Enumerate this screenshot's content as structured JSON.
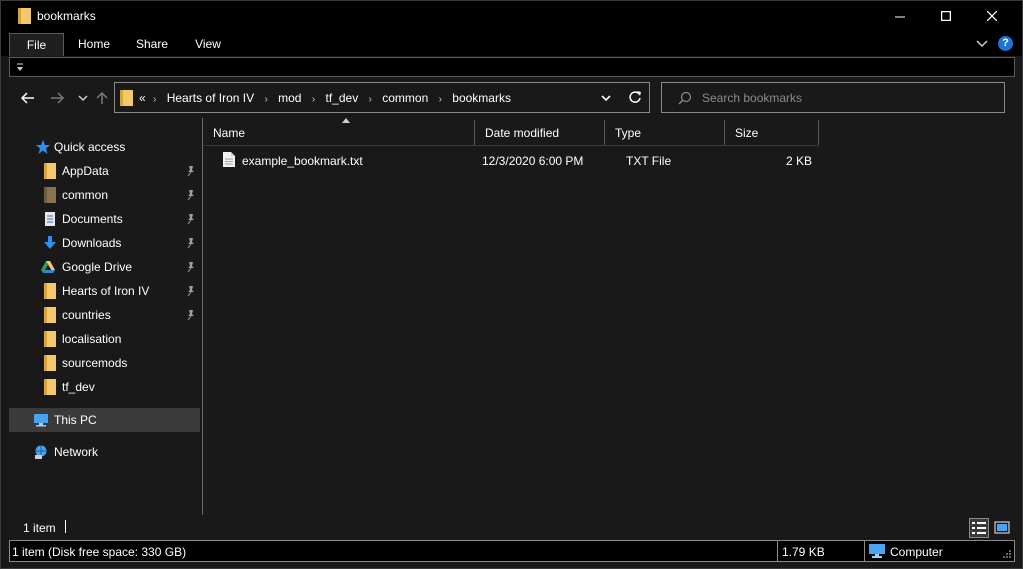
{
  "window": {
    "title": "bookmarks"
  },
  "title_buttons": {
    "minimize": "minimize-icon",
    "maximize": "maximize-icon",
    "close": "close-icon"
  },
  "ribbon": {
    "tabs": [
      {
        "label": "File"
      },
      {
        "label": "Home"
      },
      {
        "label": "Share"
      },
      {
        "label": "View"
      }
    ],
    "help_label": "?"
  },
  "address": {
    "overflow": "«",
    "crumbs": [
      "Hearts of Iron IV",
      "mod",
      "tf_dev",
      "common",
      "bookmarks"
    ],
    "separator": "›"
  },
  "search": {
    "placeholder": "Search bookmarks"
  },
  "sidebar": {
    "items": [
      {
        "label": "Quick access",
        "icon": "star-icon"
      },
      {
        "label": "AppData",
        "icon": "folder-icon",
        "pinned": true
      },
      {
        "label": "common",
        "icon": "folder-icon",
        "pinned": true
      },
      {
        "label": "Documents",
        "icon": "documents-icon",
        "pinned": true
      },
      {
        "label": "Downloads",
        "icon": "download-icon",
        "pinned": true
      },
      {
        "label": "Google Drive",
        "icon": "google-drive-icon",
        "pinned": true
      },
      {
        "label": "Hearts of Iron IV",
        "icon": "folder-icon",
        "pinned": true
      },
      {
        "label": "countries",
        "icon": "folder-icon",
        "pinned": true
      },
      {
        "label": "localisation",
        "icon": "folder-icon"
      },
      {
        "label": "sourcemods",
        "icon": "folder-icon"
      },
      {
        "label": "tf_dev",
        "icon": "folder-icon"
      },
      {
        "label": "This PC",
        "icon": "this-pc-icon",
        "selected": true
      },
      {
        "label": "Network",
        "icon": "network-icon"
      }
    ]
  },
  "file_list": {
    "columns": [
      "Name",
      "Date modified",
      "Type",
      "Size"
    ],
    "rows": [
      {
        "name": "example_bookmark.txt",
        "date": "12/3/2020 6:00 PM",
        "type": "TXT File",
        "size": "2 KB"
      }
    ]
  },
  "footer": {
    "item_count": "1 item"
  },
  "status": {
    "summary": "1 item (Disk free space: 330 GB)",
    "size": "1.79 KB",
    "location": "Computer"
  },
  "colors": {
    "background": "#191919",
    "titlebar": "#000000",
    "folder": "#f3c96a",
    "accent": "#1e74d4",
    "selected": "#3a3a3a"
  }
}
